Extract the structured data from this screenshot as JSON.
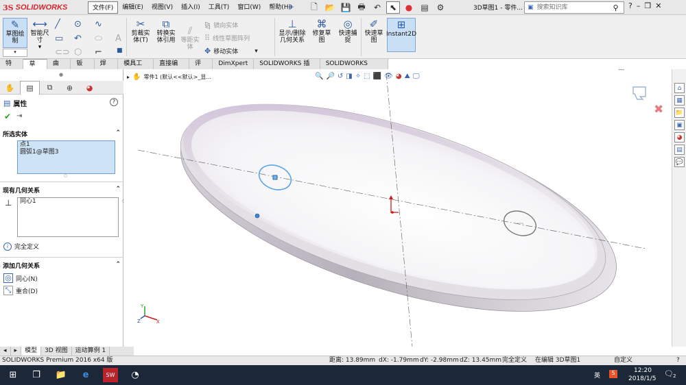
{
  "app": {
    "brand": "SOLIDWORKS",
    "doc_title": "3D草图1 - 零件..."
  },
  "menu": [
    "文件(F)",
    "编辑(E)",
    "视图(V)",
    "插入(I)",
    "工具(T)",
    "窗口(W)",
    "帮助(H)"
  ],
  "search": {
    "placeholder": "搜索知识库"
  },
  "command_manager": {
    "sketch": "草图绘制",
    "smart_dim": "智能尺寸",
    "trim": "剪裁实体(T)",
    "convert": "转换实体引用",
    "offset": "等距实体",
    "mirror": "镜向实体",
    "linear_pattern": "线性草图阵列",
    "move": "移动实体",
    "display_relations": "显示/删除几何关系",
    "repair": "修复草图",
    "quick_snaps": "快速捕捉",
    "rapid_sketch": "快速草图",
    "instant2d": "Instant2D"
  },
  "tabs": [
    "特征",
    "草图",
    "曲面",
    "钣金",
    "焊件",
    "模具工具",
    "直接编辑",
    "评估",
    "DimXpert",
    "SOLIDWORKS 插件",
    "SOLIDWORKS MBD"
  ],
  "property_manager": {
    "title": "属性",
    "selected_header": "所选实体",
    "selected": [
      "点1",
      "圆弧1@草图3"
    ],
    "existing_header": "现有几何关系",
    "existing": [
      "同心1"
    ],
    "status": "完全定义",
    "add_header": "添加几何关系",
    "add": [
      "同心(N)",
      "重合(D)"
    ]
  },
  "viewport": {
    "tree_label": "零件1  (默认<<默认>_显..."
  },
  "bottom_tabs": [
    "模型",
    "3D 视图",
    "运动算例 1"
  ],
  "status": {
    "product": "SOLIDWORKS Premium 2016 x64 版",
    "distance": "距离: 13.89mm",
    "dx": "dX: -1.79mm",
    "dy": "dY: -2.98mm",
    "dz": "dZ: 13.45mm",
    "state": "完全定义",
    "editing": "在编辑 3D草图1",
    "custom": "自定义"
  },
  "taskbar": {
    "time": "12:20",
    "date": "2018/1/5",
    "ime": "英",
    "notif": "2"
  },
  "colors": {
    "accent": "#2c5aa0",
    "selection": "#cfe3f6",
    "sketch_blue": "#5aa6e6",
    "brand_red": "#d8262e"
  }
}
